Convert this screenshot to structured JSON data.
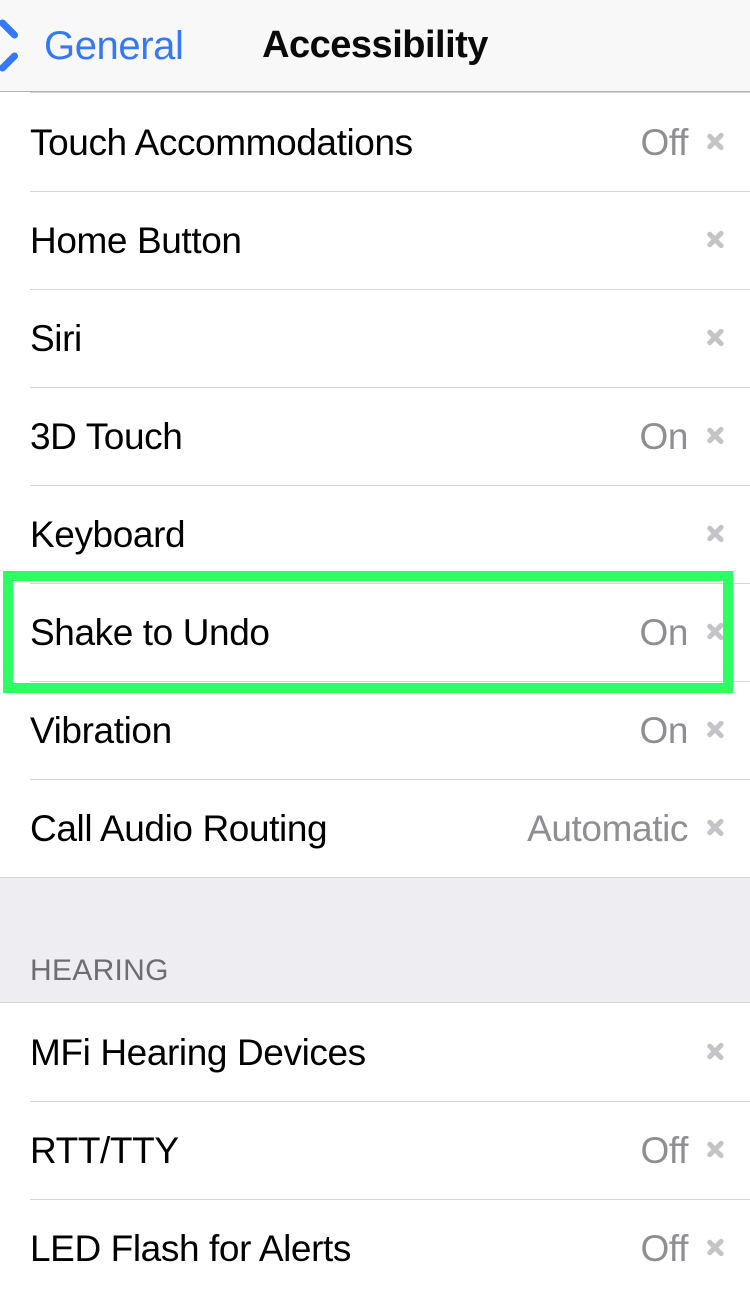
{
  "navbar": {
    "back_label": "General",
    "title": "Accessibility",
    "back_icon": "chevron-left-icon",
    "accent_color": "#3579f6"
  },
  "colors": {
    "navbar_background": "#f8f8f8",
    "row_background": "#ffffff",
    "separator": "#d4d4d6",
    "group_background": "#eeeef2",
    "value_text": "#8e8e93",
    "label_text": "#000000",
    "chevron": "#c4c4c8",
    "highlight": "#2eff62"
  },
  "sections": [
    {
      "header": "",
      "rows": [
        {
          "label": "Touch Accommodations",
          "value": "Off",
          "chevron": "chevron-right-icon"
        },
        {
          "label": "Home Button",
          "value": "",
          "chevron": "chevron-right-icon"
        },
        {
          "label": "Siri",
          "value": "",
          "chevron": "chevron-right-icon"
        },
        {
          "label": "3D Touch",
          "value": "On",
          "chevron": "chevron-right-icon"
        },
        {
          "label": "Keyboard",
          "value": "",
          "chevron": "chevron-right-icon"
        },
        {
          "label": "Shake to Undo",
          "value": "On",
          "chevron": "chevron-right-icon"
        },
        {
          "label": "Vibration",
          "value": "On",
          "chevron": "chevron-right-icon"
        },
        {
          "label": "Call Audio Routing",
          "value": "Automatic",
          "chevron": "chevron-right-icon"
        }
      ]
    },
    {
      "header": "HEARING",
      "rows": [
        {
          "label": "MFi Hearing Devices",
          "value": "",
          "chevron": "chevron-right-icon"
        },
        {
          "label": "RTT/TTY",
          "value": "Off",
          "chevron": "chevron-right-icon"
        },
        {
          "label": "LED Flash for Alerts",
          "value": "Off",
          "chevron": "chevron-right-icon"
        }
      ]
    }
  ],
  "annotation": {
    "target_row_label": "Shake to Undo",
    "type": "selection-highlight"
  }
}
